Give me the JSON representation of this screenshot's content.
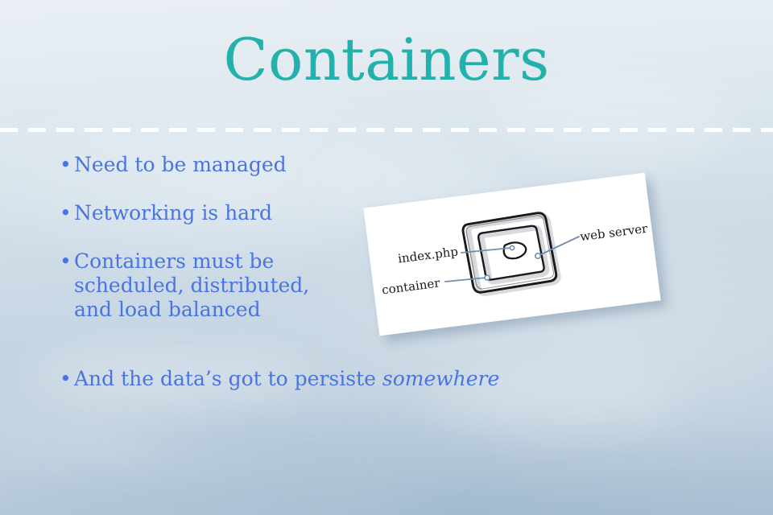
{
  "slide": {
    "title": "Containers",
    "title_color": "#22b2ab",
    "bullet_color": "#4a74de",
    "divider": "dashed-white-rule"
  },
  "bullets": [
    {
      "marker": "•",
      "text": "Need to be managed"
    },
    {
      "marker": "•",
      "text": "Networking is hard"
    },
    {
      "marker": "•",
      "text": "Containers must be scheduled, distributed, and load balanced"
    },
    {
      "marker": "•",
      "text": "And the data’s got to persiste ",
      "emphasis": "somewhere"
    }
  ],
  "sketch": {
    "alt": "hand-drawn diagram on a tilted white card",
    "labels": {
      "index": "index.php",
      "container": "container",
      "web_server": "web server"
    },
    "leader_color": "#6f8fae",
    "ink_color": "#1a1a1a"
  }
}
